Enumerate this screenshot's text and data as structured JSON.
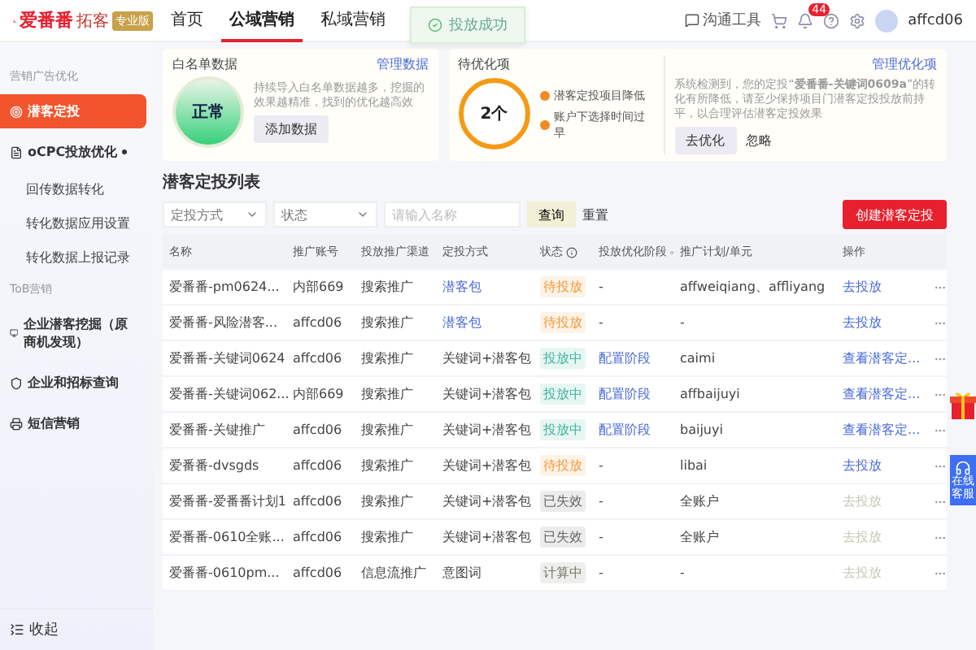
{
  "header": {
    "logo": "爱番番",
    "logo_sub": "拓客",
    "edition": "专业版",
    "nav": [
      {
        "label": "首页",
        "selected": false
      },
      {
        "label": "公域营销",
        "selected": true
      },
      {
        "label": "私域营销",
        "selected": false
      }
    ],
    "tool": "沟通工具",
    "badge": "44",
    "user": "affcd06"
  },
  "toast": "投放成功",
  "sidebar": {
    "sections": [
      {
        "title": "营销广告优化",
        "items": [
          {
            "label": "潜客定投",
            "selected": true
          },
          {
            "label": "oCPC投放优化",
            "selected": false,
            "expanded": true,
            "children": [
              {
                "label": "回传数据转化"
              },
              {
                "label": "转化数据应用设置"
              },
              {
                "label": "转化数据上报记录"
              }
            ]
          }
        ]
      },
      {
        "title": "ToB营销",
        "items": [
          {
            "label": "企业潜客挖掘（原商机发现）",
            "selected": false
          },
          {
            "label": "企业和招标查询",
            "selected": false
          },
          {
            "label": "短信营销",
            "selected": false
          }
        ]
      }
    ],
    "collapse": "收起"
  },
  "data_card": {
    "title": "白名单数据",
    "link": "管理数据",
    "status": "正常",
    "text": "持续导入白名单数据越多，挖掘的效果越精准，找到的优化越高效",
    "button": "添加数据"
  },
  "optimize_card": {
    "title": "待优化项",
    "count": "2个",
    "items": [
      "潜客定投项目降低",
      "账户下选择时间过早"
    ],
    "link": "管理优化项",
    "text": "系统检测到，您的定投“**爱番番-关键词0609a**”的转化有所降低，请至少保持项目门潜客定投投放前持平，以合理评估潜客定投效果",
    "primary": "去优化",
    "secondary": "忽略"
  },
  "list": {
    "title": "潜客定投列表",
    "filters": {
      "method": "定投方式",
      "status": "状态",
      "search_placeholder": "请输入名称",
      "query": "查询",
      "reset": "重置"
    },
    "create": "创建潜客定投",
    "columns": [
      {
        "label": "名称",
        "help": false
      },
      {
        "label": "推广账号",
        "help": false
      },
      {
        "label": "投放推广渠道",
        "help": false
      },
      {
        "label": "定投方式",
        "help": false
      },
      {
        "label": "状态",
        "help": true
      },
      {
        "label": "投放优化阶段",
        "help": true
      },
      {
        "label": "推广计划/单元",
        "help": false
      },
      {
        "label": "操作",
        "help": false
      }
    ],
    "rows": [
      {
        "name": "爱番番-pm0624...",
        "account": "内部669",
        "channel": "搜索推广",
        "method": "潜客包",
        "method_link": true,
        "status": "待投放",
        "color": "#f09a3a",
        "stage": "-",
        "stage_link": false,
        "plan": "affweiqiang、affliyang",
        "action": "去投放",
        "action_disabled": false
      },
      {
        "name": "爱番番-风险潜客...",
        "account": "affcd06",
        "channel": "搜索推广",
        "method": "潜客包",
        "method_link": true,
        "status": "待投放",
        "color": "#f09a3a",
        "stage": "-",
        "stage_link": false,
        "plan": "-",
        "action": "去投放",
        "action_disabled": false
      },
      {
        "name": "爱番番-关键词0624",
        "account": "affcd06",
        "channel": "搜索推广",
        "method": "关键词+潜客包",
        "method_link": false,
        "status": "投放中",
        "color": "#3bb59a",
        "stage": "配置阶段",
        "stage_link": true,
        "plan": "caimi",
        "action": "查看潜客定...",
        "action_disabled": false
      },
      {
        "name": "爱番番-关键词062...",
        "account": "内部669",
        "channel": "搜索推广",
        "method": "关键词+潜客包",
        "method_link": false,
        "status": "投放中",
        "color": "#3bb59a",
        "stage": "配置阶段",
        "stage_link": true,
        "plan": "affbaijuyi",
        "action": "查看潜客定...",
        "action_disabled": false
      },
      {
        "name": "爱番番-关键推广",
        "account": "affcd06",
        "channel": "搜索推广",
        "method": "关键词+潜客包",
        "method_link": false,
        "status": "投放中",
        "color": "#3bb59a",
        "stage": "配置阶段",
        "stage_link": true,
        "plan": "baijuyi",
        "action": "查看潜客定...",
        "action_disabled": false
      },
      {
        "name": "爱番番-dvsgds",
        "account": "affcd06",
        "channel": "搜索推广",
        "method": "关键词+潜客包",
        "method_link": false,
        "status": "待投放",
        "color": "#f09a3a",
        "stage": "-",
        "stage_link": false,
        "plan": "libai",
        "action": "去投放",
        "action_disabled": false
      },
      {
        "name": "爱番番-爱番番计划1",
        "account": "affcd06",
        "channel": "搜索推广",
        "method": "关键词+潜客包",
        "method_link": false,
        "status": "已失效",
        "color": "#666666",
        "stage": "-",
        "stage_link": false,
        "plan": "全账户",
        "action": "去投放",
        "action_disabled": true
      },
      {
        "name": "爱番番-0610全账...",
        "account": "affcd06",
        "channel": "搜索推广",
        "method": "关键词+潜客包",
        "method_link": false,
        "status": "已失效",
        "color": "#666666",
        "stage": "-",
        "stage_link": false,
        "plan": "全账户",
        "action": "去投放",
        "action_disabled": true
      },
      {
        "name": "爱番番-0610pm...",
        "account": "affcd06",
        "channel": "信息流推广",
        "method": "意图词",
        "method_link": false,
        "status": "计算中",
        "color": "#777766",
        "stage": "-",
        "stage_link": false,
        "plan": "-",
        "action": "去投放",
        "action_disabled": true
      }
    ]
  },
  "service": "在线客服"
}
